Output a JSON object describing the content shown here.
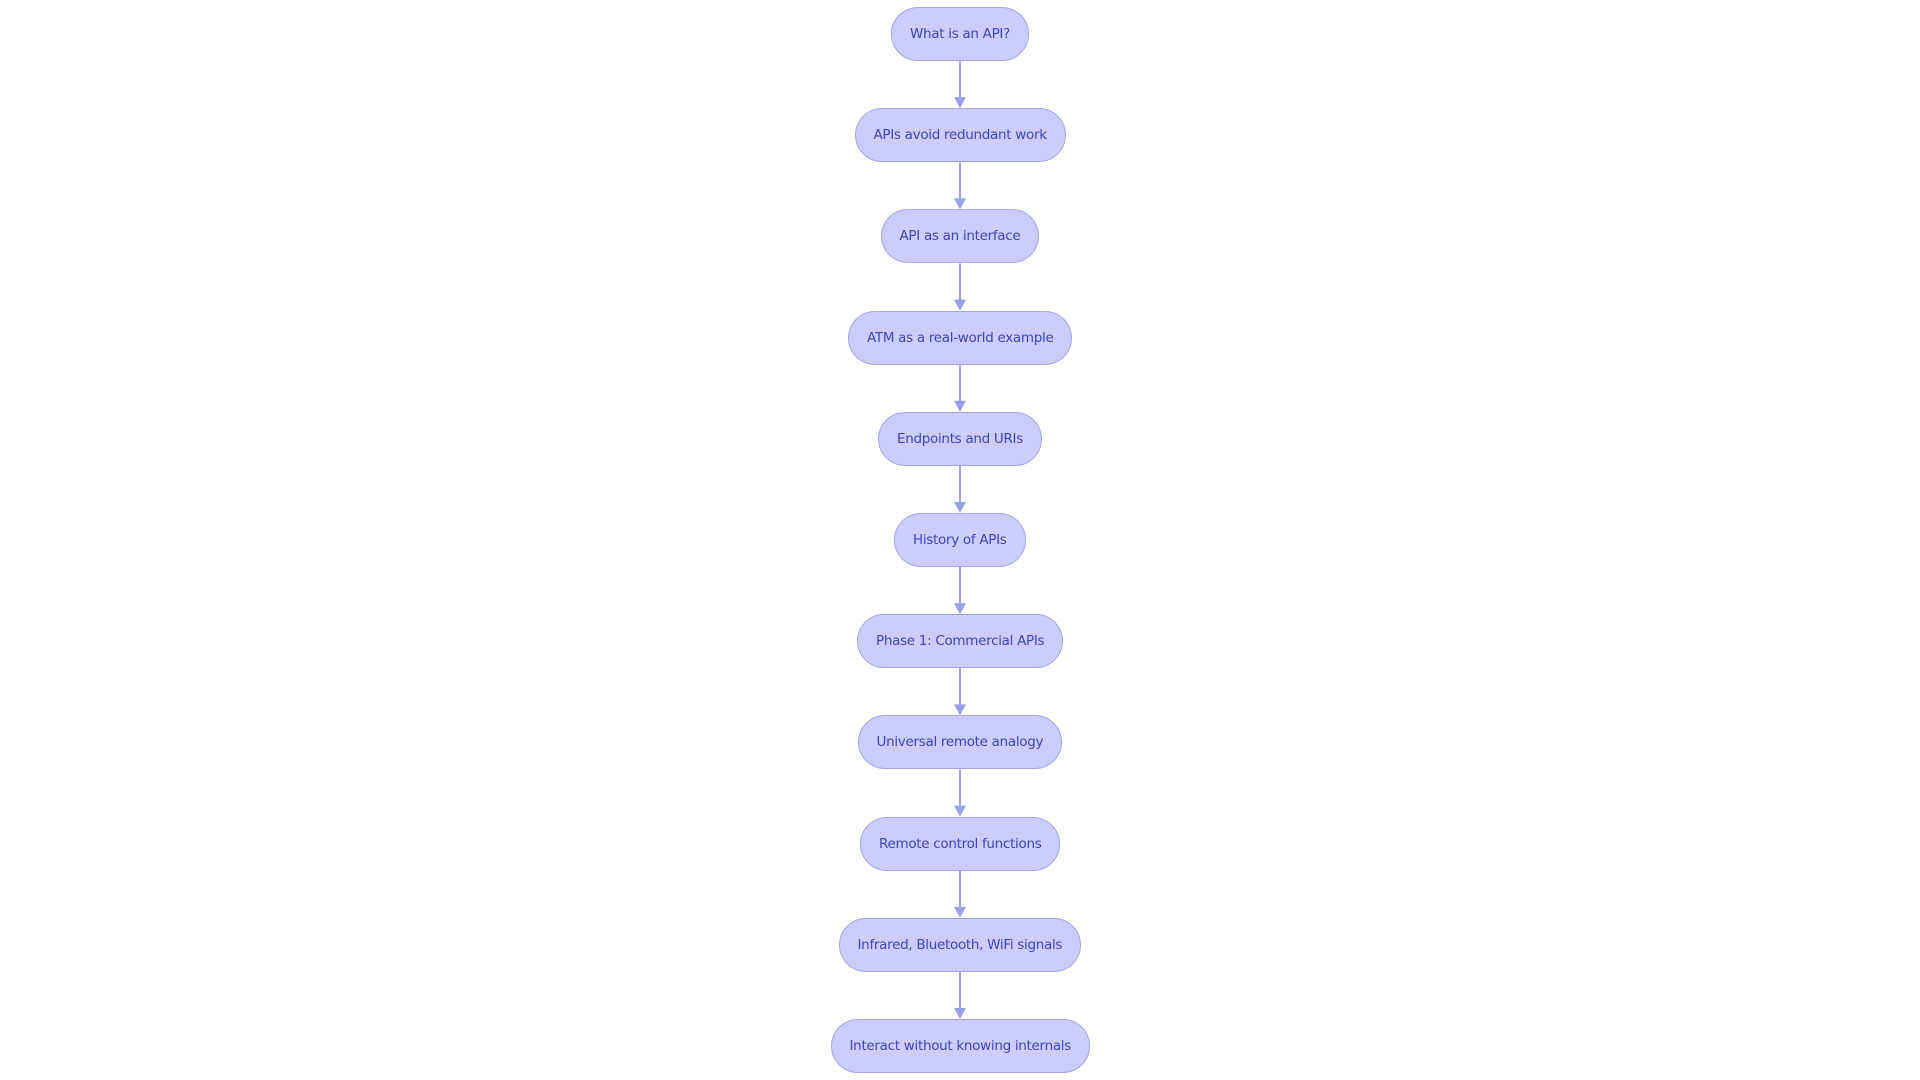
{
  "diagram": {
    "type": "flowchart",
    "direction": "top-to-bottom",
    "colors": {
      "node_fill": "#cccdfa",
      "node_border": "#a3a4ea",
      "node_text": "#3f44b8",
      "edge": "#9a9fe6"
    },
    "nodes": [
      {
        "id": "n1",
        "label": "What is an API?"
      },
      {
        "id": "n2",
        "label": "APIs avoid redundant work"
      },
      {
        "id": "n3",
        "label": "API as an interface"
      },
      {
        "id": "n4",
        "label": "ATM as a real-world example"
      },
      {
        "id": "n5",
        "label": "Endpoints and URIs"
      },
      {
        "id": "n6",
        "label": "History of APIs"
      },
      {
        "id": "n7",
        "label": "Phase 1: Commercial APIs"
      },
      {
        "id": "n8",
        "label": "Universal remote analogy"
      },
      {
        "id": "n9",
        "label": "Remote control functions"
      },
      {
        "id": "n10",
        "label": "Infrared, Bluetooth, WiFi signals"
      },
      {
        "id": "n11",
        "label": "Interact without knowing internals"
      }
    ],
    "edges": [
      {
        "from": "n1",
        "to": "n2"
      },
      {
        "from": "n2",
        "to": "n3"
      },
      {
        "from": "n3",
        "to": "n4"
      },
      {
        "from": "n4",
        "to": "n5"
      },
      {
        "from": "n5",
        "to": "n6"
      },
      {
        "from": "n6",
        "to": "n7"
      },
      {
        "from": "n7",
        "to": "n8"
      },
      {
        "from": "n8",
        "to": "n9"
      },
      {
        "from": "n9",
        "to": "n10"
      },
      {
        "from": "n10",
        "to": "n11"
      }
    ]
  }
}
